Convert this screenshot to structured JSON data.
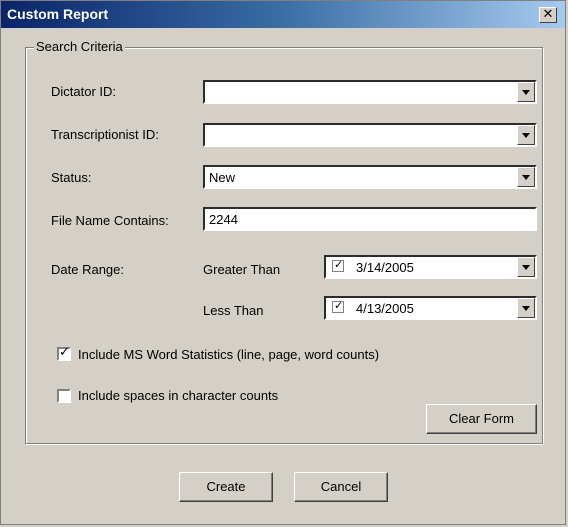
{
  "window": {
    "title": "Custom Report",
    "close_glyph": "✕"
  },
  "groupbox": {
    "label": "Search Criteria"
  },
  "fields": {
    "dictator_id": {
      "label": "Dictator ID:",
      "value": ""
    },
    "transcriptionist_id": {
      "label": "Transcriptionist ID:",
      "value": ""
    },
    "status": {
      "label": "Status:",
      "value": "New"
    },
    "file_name_contains": {
      "label": "File Name Contains:",
      "value": "2244"
    },
    "date_range": {
      "label": "Date Range:",
      "greater_than_label": "Greater Than",
      "greater_than_value": "3/14/2005",
      "greater_than_enabled": true,
      "less_than_label": "Less Than",
      "less_than_value": "4/13/2005",
      "less_than_enabled": true
    }
  },
  "options": {
    "include_word_stats": {
      "label": "Include MS Word Statistics (line, page, word counts)",
      "checked": true
    },
    "include_spaces": {
      "label": "Include spaces in character counts",
      "checked": false
    }
  },
  "buttons": {
    "clear_form": "Clear Form",
    "create": "Create",
    "cancel": "Cancel"
  },
  "icons": {
    "dropdown": "chevron-down-icon",
    "check": "✓"
  }
}
